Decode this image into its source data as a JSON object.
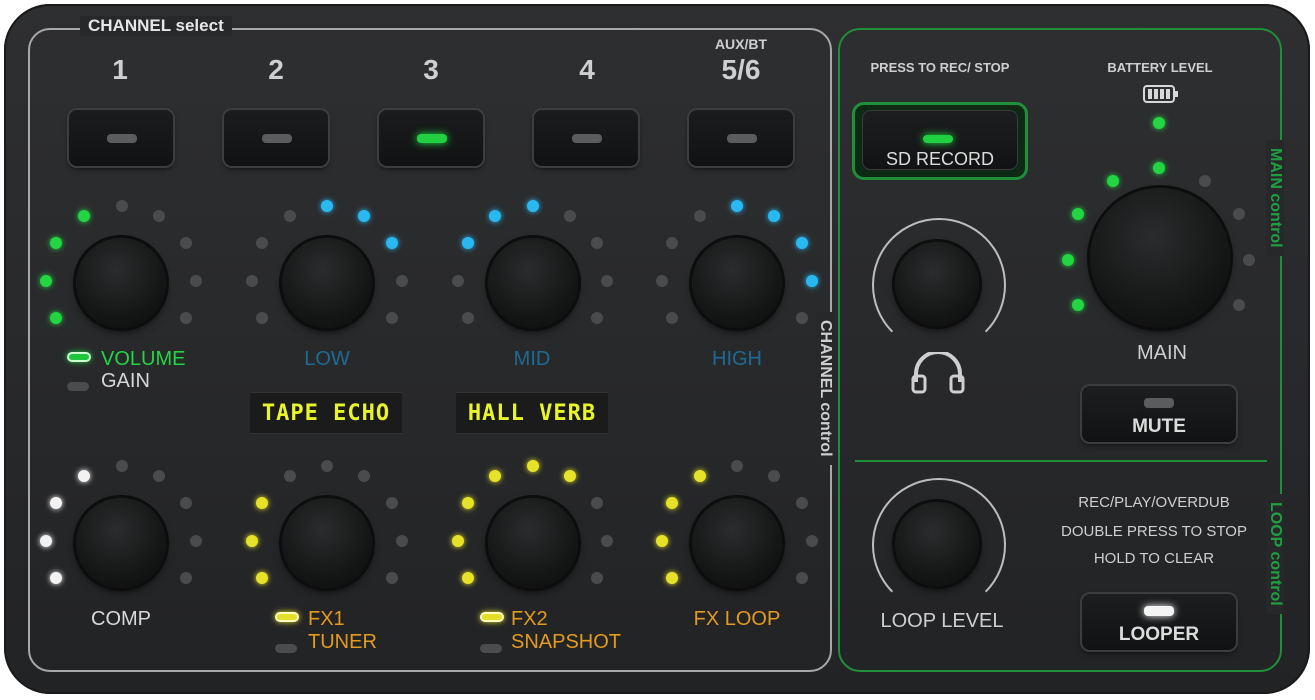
{
  "channel_select": {
    "title": "CHANNEL select",
    "channels": [
      {
        "number": "1",
        "sub": "",
        "active": false
      },
      {
        "number": "2",
        "sub": "",
        "active": false
      },
      {
        "number": "3",
        "sub": "",
        "active": true
      },
      {
        "number": "4",
        "sub": "",
        "active": false
      },
      {
        "number": "5/6",
        "sub": "AUX/BT",
        "active": false
      }
    ]
  },
  "channel_control": {
    "side_label": "CHANNEL control",
    "knobs_top": [
      {
        "label": "VOLUME",
        "sub_label": "GAIN",
        "color": "#23d443"
      },
      {
        "label": "LOW",
        "color": "#1d6b94"
      },
      {
        "label": "MID",
        "color": "#1d6b94"
      },
      {
        "label": "HIGH",
        "color": "#1d6b94"
      }
    ],
    "displays": [
      "TAPE ECHO",
      "HALL VERB"
    ],
    "knobs_bottom": [
      {
        "label": "COMP",
        "color": "#d8d8d8"
      },
      {
        "label": "FX1",
        "sub_label": "TUNER",
        "color": "#e29a20"
      },
      {
        "label": "FX2",
        "sub_label": "SNAPSHOT",
        "color": "#e29a20"
      },
      {
        "label": "FX LOOP",
        "color": "#e29a20"
      }
    ]
  },
  "main_control": {
    "side_label": "MAIN control",
    "record_hint": "PRESS TO REC/ STOP",
    "record_button": "SD RECORD",
    "battery_label": "BATTERY LEVEL",
    "main_knob_label": "MAIN",
    "mute_button": "MUTE",
    "headphone_icon": "headphones-icon"
  },
  "loop_control": {
    "side_label": "LOOP control",
    "loop_knob_label": "LOOP LEVEL",
    "instructions": [
      "REC/PLAY/OVERDUB",
      "DOUBLE PRESS TO STOP",
      "HOLD TO CLEAR"
    ],
    "looper_button": "LOOPER"
  }
}
